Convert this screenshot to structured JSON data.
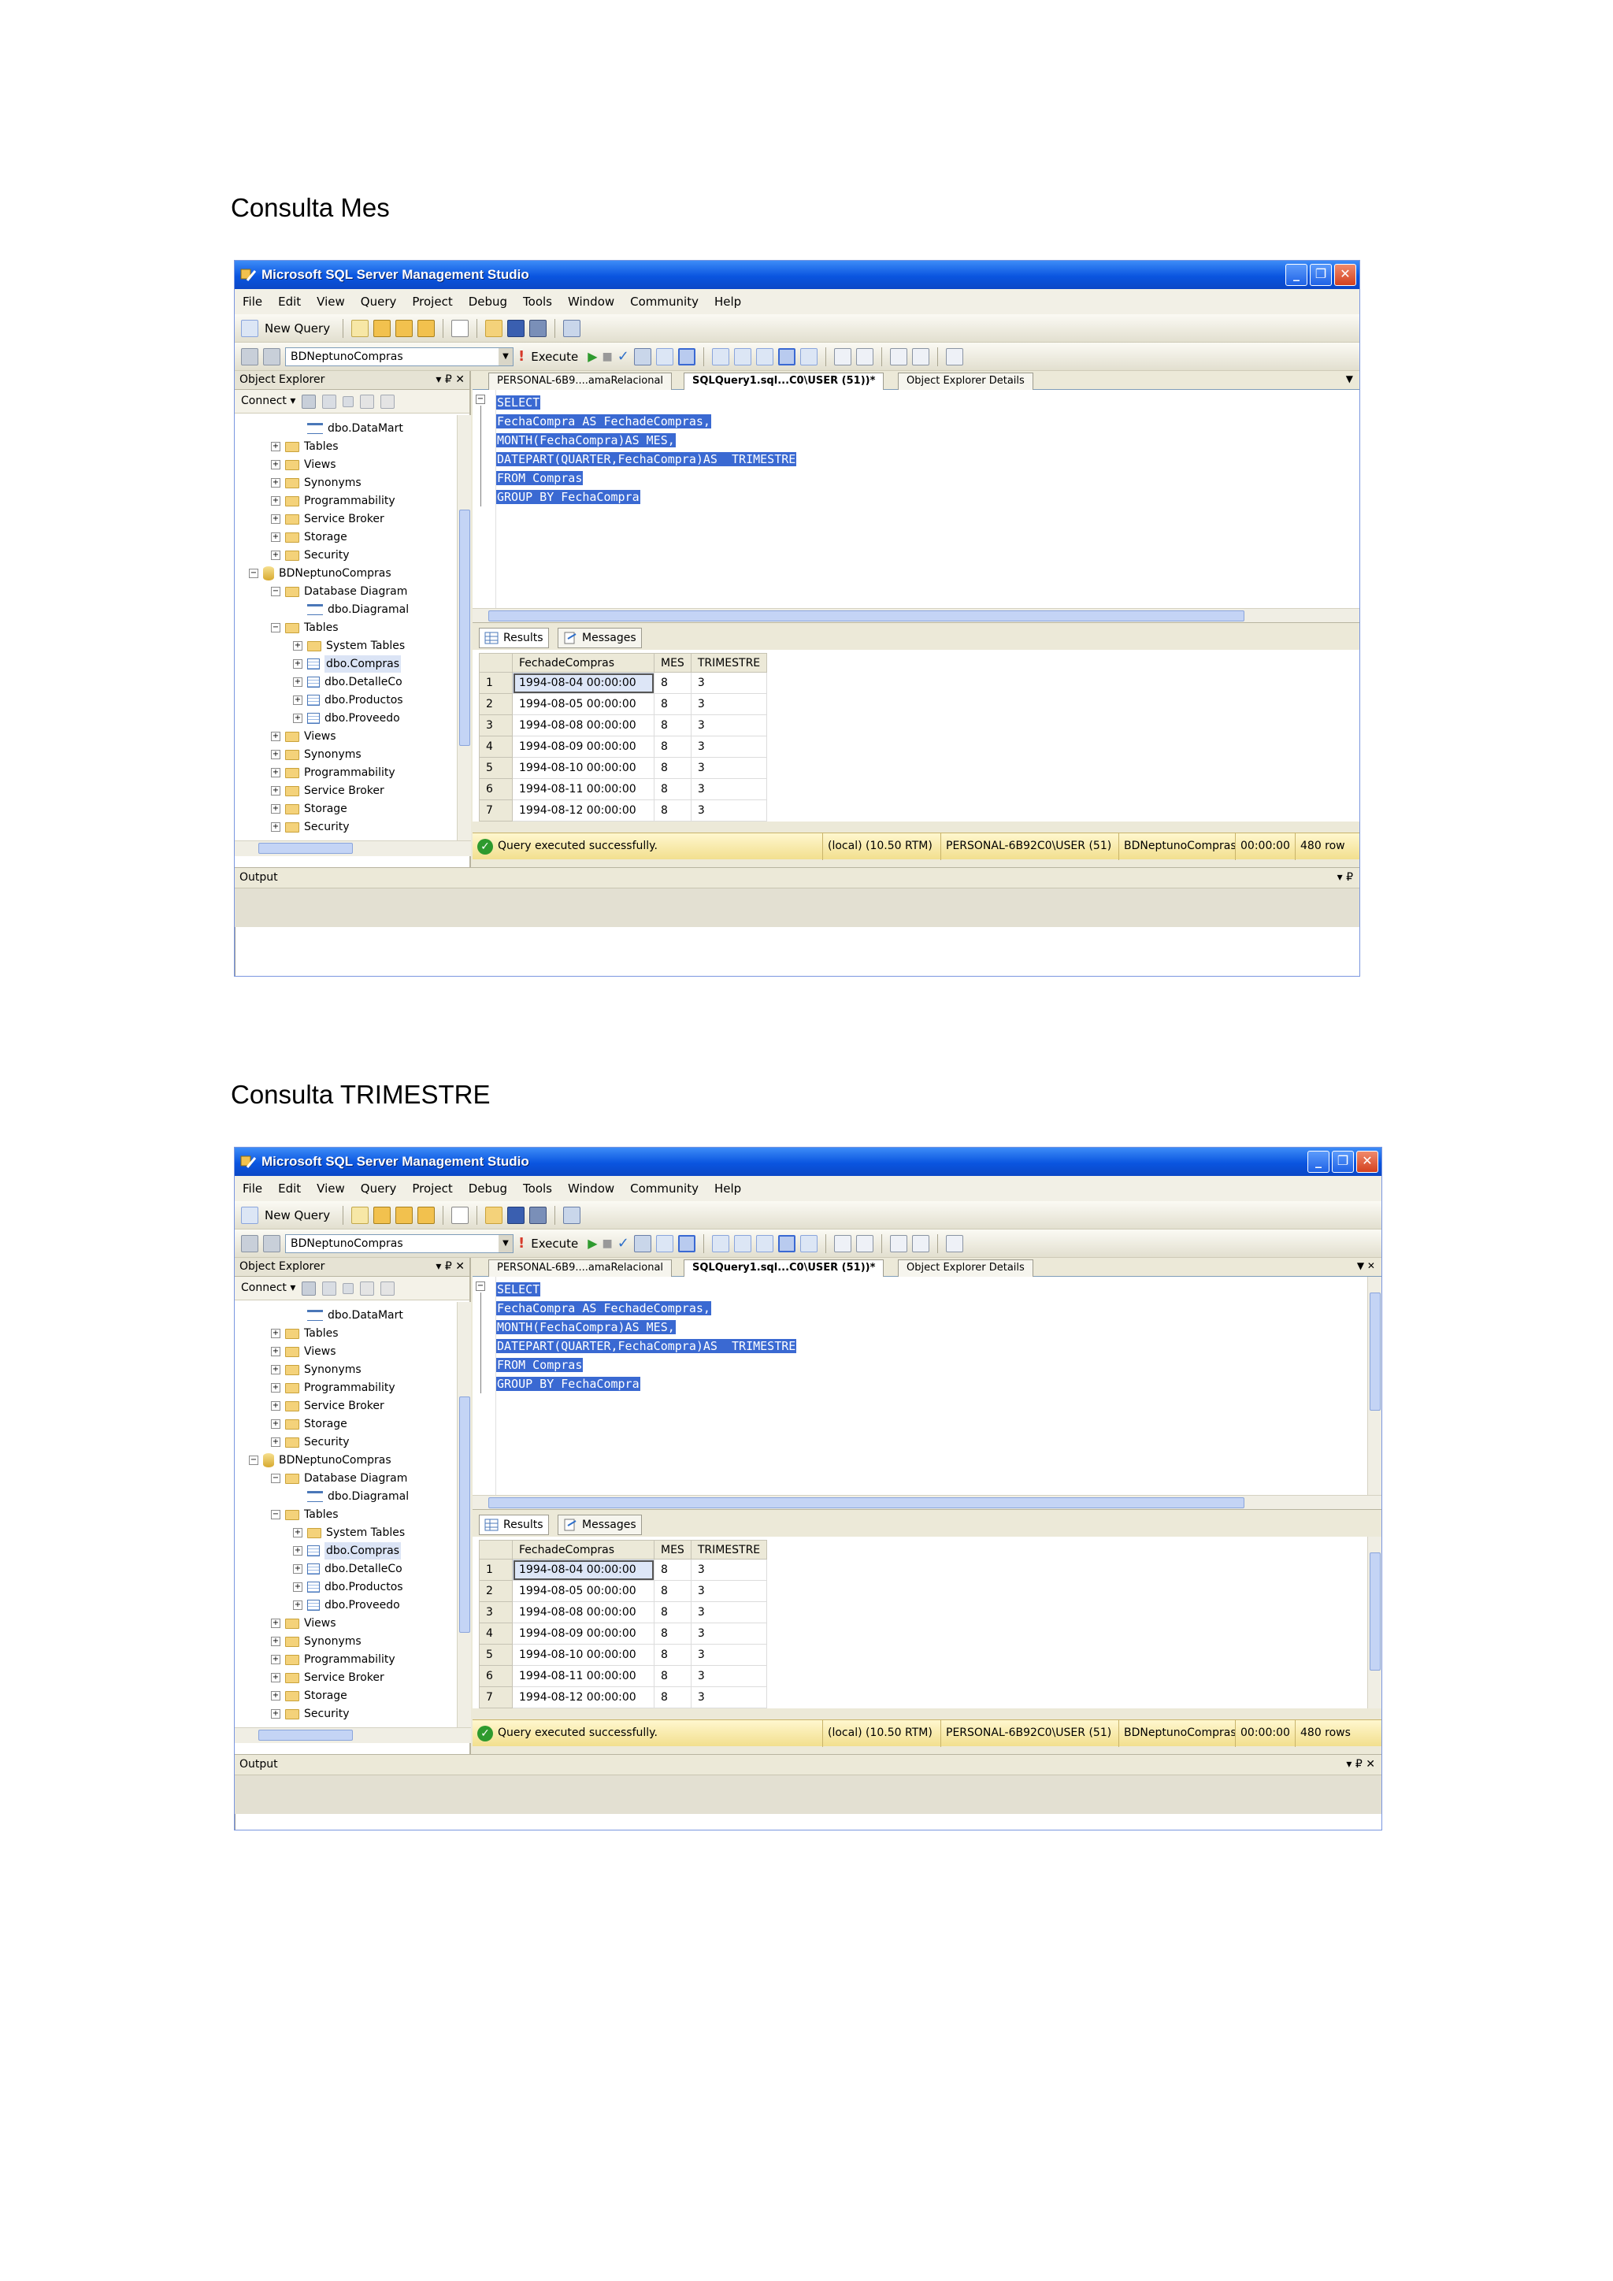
{
  "doc": {
    "heading1": "Consulta Mes",
    "heading2": "Consulta TRIMESTRE"
  },
  "app": {
    "title": "Microsoft SQL Server Management Studio",
    "menu": [
      "File",
      "Edit",
      "View",
      "Query",
      "Project",
      "Debug",
      "Tools",
      "Window",
      "Community",
      "Help"
    ],
    "toolbar": {
      "new_query": "New Query",
      "database": "BDNeptunoCompras",
      "execute": "Execute"
    },
    "object_explorer": {
      "title": "Object Explorer",
      "controls": "▾ ₽ ✕",
      "connect": "Connect ▾",
      "tree": [
        {
          "label": "dbo.DataMart",
          "icon": "diagram",
          "indent": 3,
          "sign": ""
        },
        {
          "label": "Tables",
          "icon": "folder",
          "indent": 2,
          "sign": "+"
        },
        {
          "label": "Views",
          "icon": "folder",
          "indent": 2,
          "sign": "+"
        },
        {
          "label": "Synonyms",
          "icon": "folder",
          "indent": 2,
          "sign": "+"
        },
        {
          "label": "Programmability",
          "icon": "folder",
          "indent": 2,
          "sign": "+"
        },
        {
          "label": "Service Broker",
          "icon": "folder",
          "indent": 2,
          "sign": "+"
        },
        {
          "label": "Storage",
          "icon": "folder",
          "indent": 2,
          "sign": "+"
        },
        {
          "label": "Security",
          "icon": "folder",
          "indent": 2,
          "sign": "+"
        },
        {
          "label": "BDNeptunoCompras",
          "icon": "database",
          "indent": 1,
          "sign": "−"
        },
        {
          "label": "Database Diagram",
          "icon": "folder",
          "indent": 2,
          "sign": "−"
        },
        {
          "label": "dbo.Diagramal",
          "icon": "diagram",
          "indent": 3,
          "sign": ""
        },
        {
          "label": "Tables",
          "icon": "folder",
          "indent": 2,
          "sign": "−"
        },
        {
          "label": "System Tables",
          "icon": "folder",
          "indent": 3,
          "sign": "+"
        },
        {
          "label": "dbo.Compras",
          "icon": "table",
          "indent": 3,
          "sign": "+",
          "selected": true
        },
        {
          "label": "dbo.DetalleCo",
          "icon": "table",
          "indent": 3,
          "sign": "+"
        },
        {
          "label": "dbo.Productos",
          "icon": "table",
          "indent": 3,
          "sign": "+"
        },
        {
          "label": "dbo.Proveedo",
          "icon": "table",
          "indent": 3,
          "sign": "+"
        },
        {
          "label": "Views",
          "icon": "folder",
          "indent": 2,
          "sign": "+"
        },
        {
          "label": "Synonyms",
          "icon": "folder",
          "indent": 2,
          "sign": "+"
        },
        {
          "label": "Programmability",
          "icon": "folder",
          "indent": 2,
          "sign": "+"
        },
        {
          "label": "Service Broker",
          "icon": "folder",
          "indent": 2,
          "sign": "+"
        },
        {
          "label": "Storage",
          "icon": "folder",
          "indent": 2,
          "sign": "+"
        },
        {
          "label": "Security",
          "icon": "folder",
          "indent": 2,
          "sign": "+"
        }
      ]
    },
    "tabs": [
      "PERSONAL-6B9....amaRelacional",
      "SQLQuery1.sql...C0\\USER (51))*",
      "Object Explorer Details"
    ],
    "code": [
      "SELECT",
      "FechaCompra AS FechadeCompras,",
      "MONTH(FechaCompra)AS MES,",
      "DATEPART(QUARTER,FechaCompra)AS  TRIMESTRE",
      "FROM Compras",
      "GROUP BY FechaCompra"
    ],
    "result_tabs": [
      "Results",
      "Messages"
    ],
    "grid": {
      "columns": [
        "",
        "FechadeCompras",
        "MES",
        "TRIMESTRE"
      ],
      "rows": [
        [
          "1",
          "1994-08-04 00:00:00",
          "8",
          "3"
        ],
        [
          "2",
          "1994-08-05 00:00:00",
          "8",
          "3"
        ],
        [
          "3",
          "1994-08-08 00:00:00",
          "8",
          "3"
        ],
        [
          "4",
          "1994-08-09 00:00:00",
          "8",
          "3"
        ],
        [
          "5",
          "1994-08-10 00:00:00",
          "8",
          "3"
        ],
        [
          "6",
          "1994-08-11 00:00:00",
          "8",
          "3"
        ],
        [
          "7",
          "1994-08-12 00:00:00",
          "8",
          "3"
        ]
      ]
    },
    "status": {
      "message": "Query executed successfully.",
      "server": "(local) (10.50 RTM)",
      "user": "PERSONAL-6B92C0\\USER (51)",
      "database": "BDNeptunoCompras",
      "time": "00:00:00",
      "rows_s1": "480 row",
      "rows_s2": "480 rows"
    },
    "output_label": "Output",
    "output_controls_s1": "▾ ₽",
    "output_controls_s2": "▾ ₽ ✕"
  },
  "colors": {
    "titlebar": "#0a55e0",
    "selection": "#3a69d2",
    "status_bar": "#f2df8e"
  }
}
